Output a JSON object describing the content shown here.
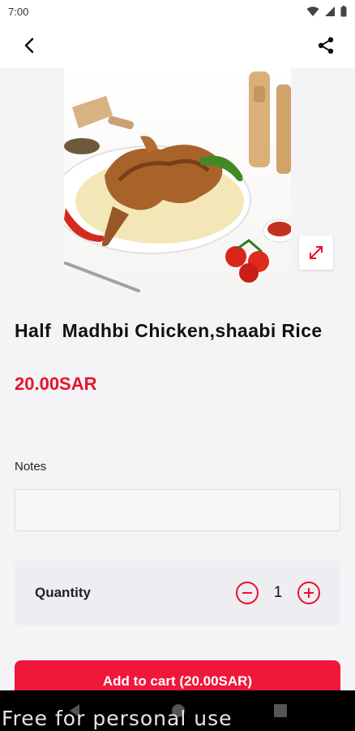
{
  "status_bar": {
    "time": "7:00"
  },
  "app_bar": {
    "back_icon": "chevron-left-icon",
    "share_icon": "share-icon"
  },
  "product": {
    "image_alt": "half chicken on rice",
    "title": "Half  Madhbi Chicken,shaabi Rice",
    "price": "20.00SAR"
  },
  "notes": {
    "label": "Notes",
    "value": "",
    "placeholder": ""
  },
  "quantity": {
    "label": "Quantity",
    "value": "1"
  },
  "cart": {
    "button_label": "Add to cart (20.00SAR)"
  },
  "watermark": "Free for personal use",
  "colors": {
    "accent": "#e8122d",
    "button": "#f0173a"
  }
}
